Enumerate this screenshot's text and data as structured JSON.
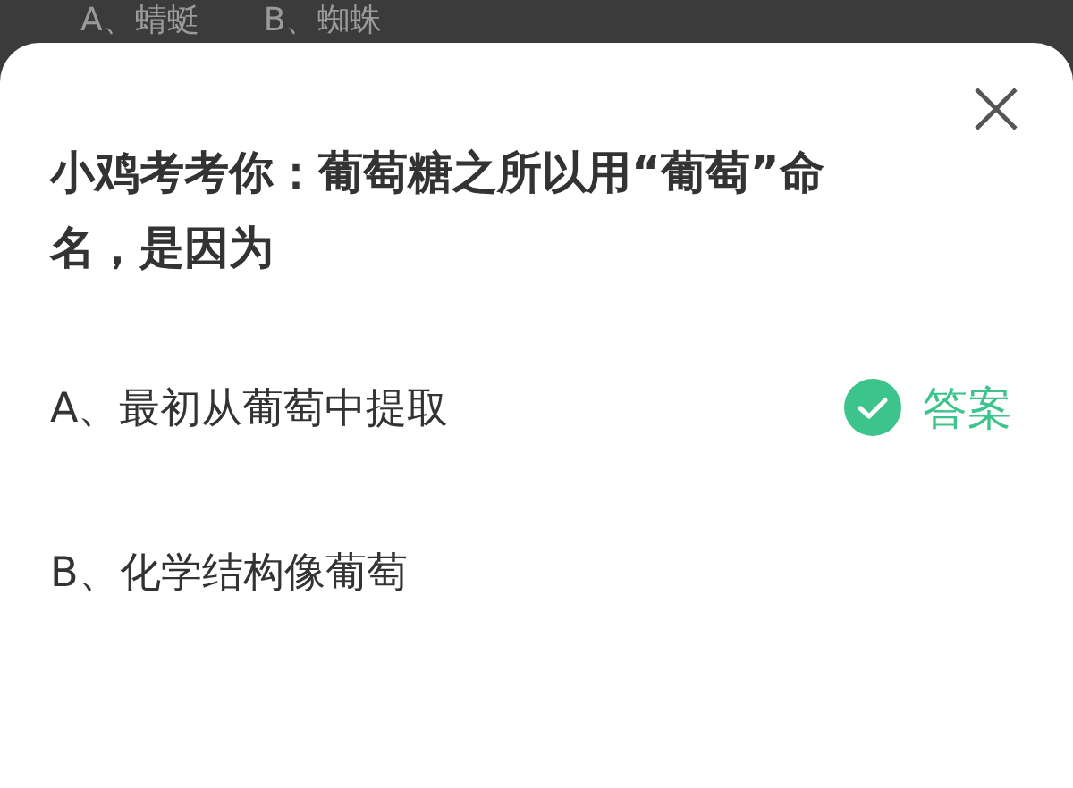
{
  "background_options": [
    "A、蜻蜓",
    "B、蜘蛛"
  ],
  "question": "小鸡考考你：葡萄糖之所以用“葡萄”命名，是因为",
  "options": [
    {
      "label": "A、最初从葡萄中提取",
      "correct": true,
      "answer_label": "答案"
    },
    {
      "label": "B、化学结构像葡萄",
      "correct": false
    }
  ]
}
